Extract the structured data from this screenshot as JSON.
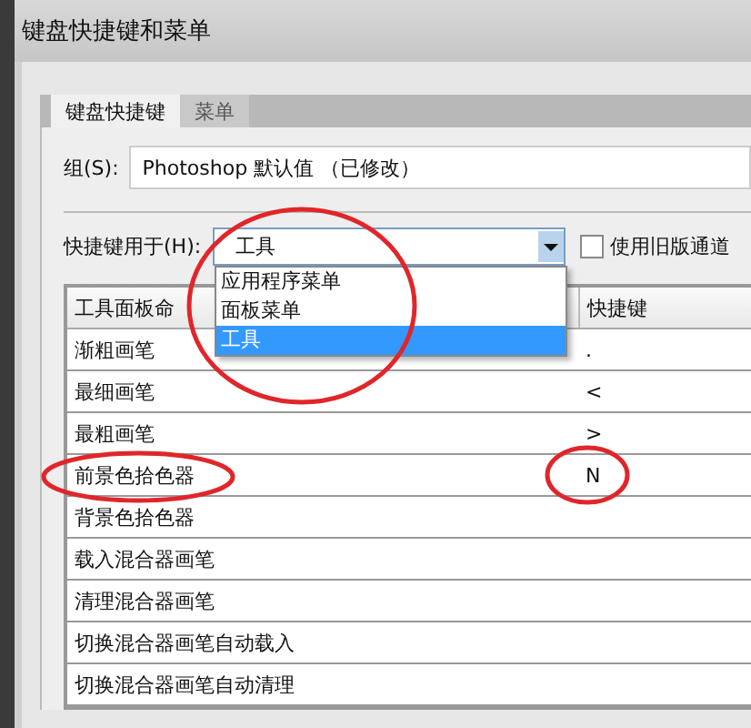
{
  "window": {
    "title": "键盘快捷键和菜单"
  },
  "tabs": [
    {
      "label": "键盘快捷键",
      "selected": true
    },
    {
      "label": "菜单",
      "selected": false
    }
  ],
  "group": {
    "label": "组(S):",
    "value": "Photoshop 默认值 （已修改）"
  },
  "shortcuts_for": {
    "label": "快捷键用于(H):",
    "value": "工具",
    "expanded": true,
    "options": [
      {
        "label": "应用程序菜单",
        "selected": false
      },
      {
        "label": "面板菜单",
        "selected": false
      },
      {
        "label": "工具",
        "selected": true
      }
    ]
  },
  "legacy_checkbox": {
    "label": "使用旧版通道",
    "checked": false
  },
  "table": {
    "columns": [
      "工具面板命",
      "快捷键"
    ],
    "rows": [
      {
        "command": "渐粗画笔",
        "shortcut": "."
      },
      {
        "command": "最细画笔",
        "shortcut": "<"
      },
      {
        "command": "最粗画笔",
        "shortcut": ">"
      },
      {
        "command": "前景色拾色器",
        "shortcut": "N"
      },
      {
        "command": "背景色拾色器",
        "shortcut": ""
      },
      {
        "command": "载入混合器画笔",
        "shortcut": ""
      },
      {
        "command": "清理混合器画笔",
        "shortcut": ""
      },
      {
        "command": "切换混合器画笔自动载入",
        "shortcut": ""
      },
      {
        "command": "切换混合器画笔自动清理",
        "shortcut": ""
      }
    ]
  }
}
